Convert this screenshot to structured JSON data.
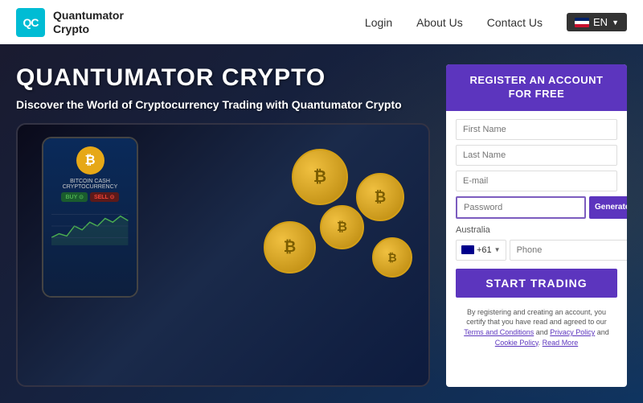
{
  "header": {
    "logo_initials": "QC",
    "logo_name_line1": "Quantumator",
    "logo_name_line2": "Crypto",
    "nav": {
      "login_label": "Login",
      "about_label": "About Us",
      "contact_label": "Contact Us",
      "lang_label": "EN"
    }
  },
  "hero": {
    "title": "QUANTUMATOR CRYPTO",
    "subtitle": "Discover the World of Cryptocurrency Trading with Quantumator Crypto",
    "phone_display": {
      "coin_label": "₿",
      "cash_label": "BITCOIN CASH\nCRYPTOCURRENCY",
      "buy_label": "BUY ⊙",
      "sell_label": "SELL ⊙"
    }
  },
  "register_form": {
    "header_line1": "REGISTER AN ACCOUNT",
    "header_line2": "FOR FREE",
    "first_name_placeholder": "First Name",
    "last_name_placeholder": "Last Name",
    "email_placeholder": "E-mail",
    "password_placeholder": "Password",
    "generate_btn_label": "Generate passwords",
    "country_label": "Australia",
    "country_code": "+61",
    "phone_placeholder": "Phone",
    "start_btn_label": "START TRADING",
    "terms_text_before": "By registering and creating an account, you certify that you have read and agreed to our ",
    "terms_link1": "Terms and Conditions",
    "terms_and": " and ",
    "terms_link2": "Privacy Policy",
    "terms_and2": " and ",
    "terms_link3": "Cookie Policy",
    "terms_read": "Read More"
  },
  "coins": [
    {
      "symbol": "₿",
      "class": "coin-1"
    },
    {
      "symbol": "₿",
      "class": "coin-2"
    },
    {
      "symbol": "₿",
      "class": "coin-3"
    },
    {
      "symbol": "₿",
      "class": "coin-4"
    },
    {
      "symbol": "₿",
      "class": "coin-5"
    }
  ]
}
